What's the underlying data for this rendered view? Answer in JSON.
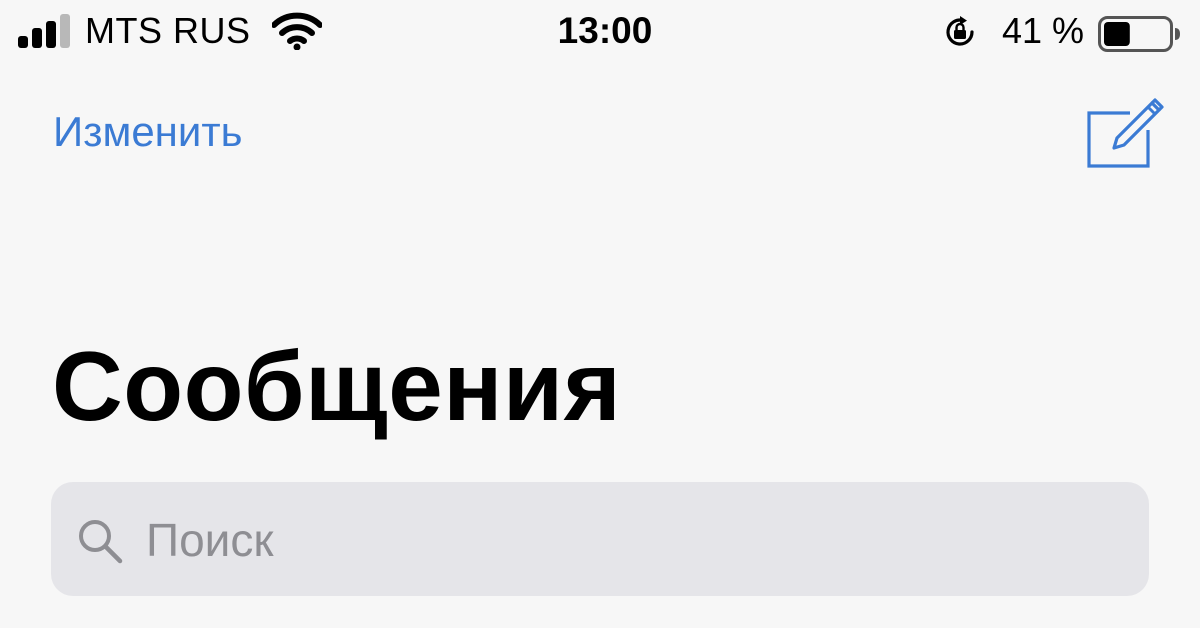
{
  "status_bar": {
    "carrier": "MTS RUS",
    "time": "13:00",
    "battery_percent": "41 %",
    "battery_level": 0.41,
    "signal_bars_active": 3,
    "signal_bars_total": 4,
    "icons": [
      "signal-icon",
      "wifi-icon",
      "rotation-lock-icon",
      "battery-icon"
    ]
  },
  "nav": {
    "edit_label": "Изменить",
    "compose_icon": "compose-icon"
  },
  "main": {
    "title": "Сообщения"
  },
  "search": {
    "placeholder": "Поиск",
    "icon": "search-icon"
  },
  "colors": {
    "accent": "#3b7bd4",
    "background": "#f7f7f7",
    "search_bg": "#e5e5e9",
    "placeholder": "#8e8e93"
  }
}
